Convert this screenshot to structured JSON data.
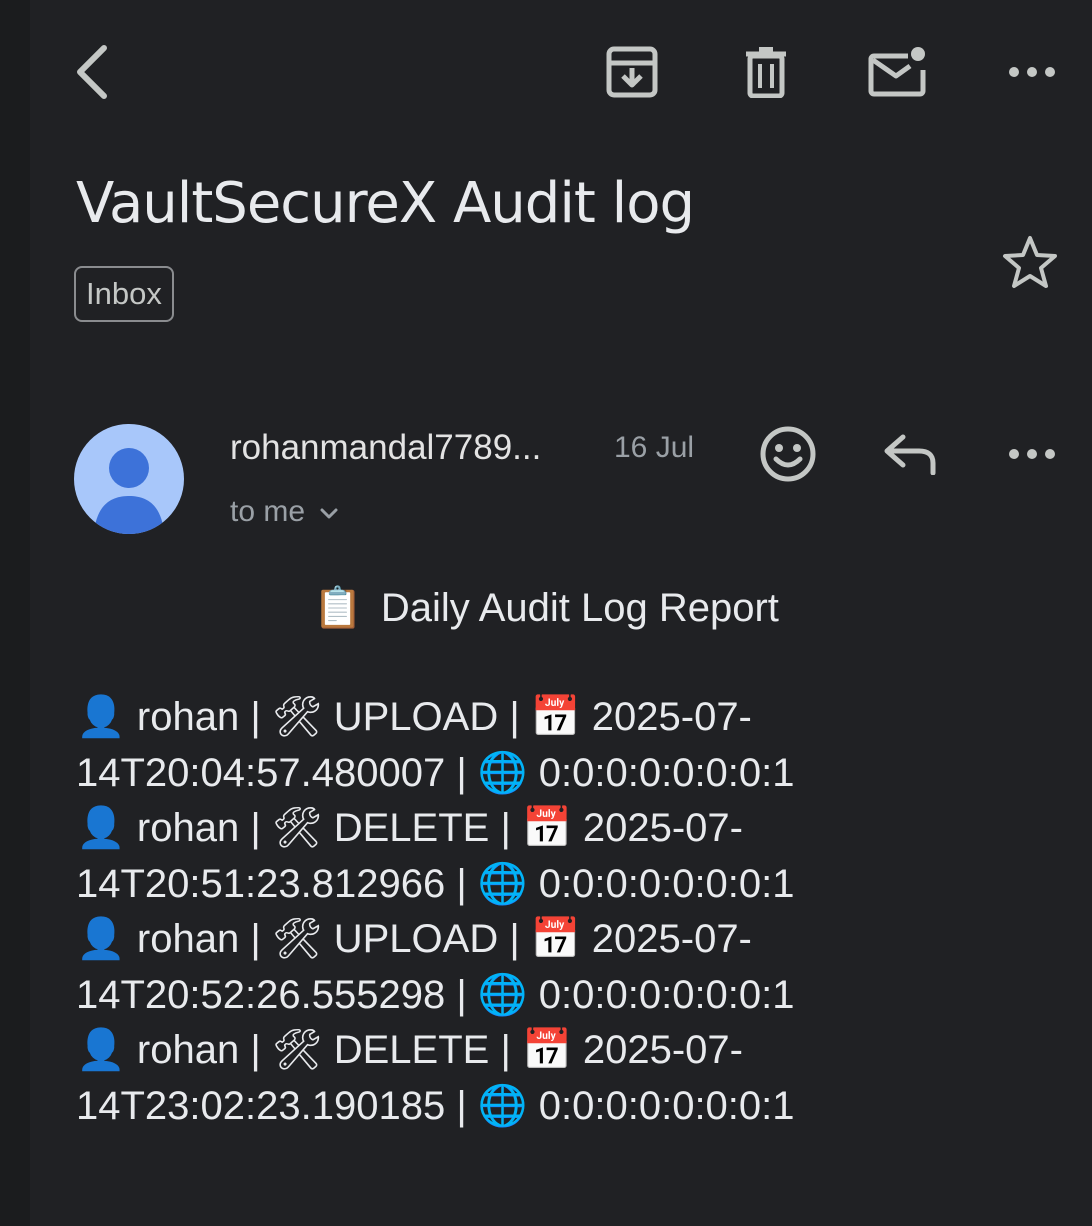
{
  "toolbar": {
    "back_icon": "chevron-left-icon",
    "archive_icon": "archive-icon",
    "delete_icon": "trash-icon",
    "unread_icon": "mark-unread-icon",
    "more_icon": "more-horizontal-icon"
  },
  "email": {
    "subject": "VaultSecureX Audit log",
    "label": "Inbox",
    "star_icon": "star-outline-icon"
  },
  "sender": {
    "name": "rohanmandal7789...",
    "date": "16 Jul",
    "recipient": "to me",
    "avatar_color": "#a8c7fa",
    "avatar_icon": "person-icon"
  },
  "message_actions": {
    "emoji_icon": "emoji-reaction-icon",
    "reply_icon": "reply-icon",
    "more_icon": "more-horizontal-icon"
  },
  "body": {
    "report_icon": "📋",
    "report_title": "Daily Audit Log Report",
    "entries": [
      {
        "line1": "👤 rohan | 🛠 UPLOAD | 📅 2025-07-",
        "line2": "14T20:04:57.480007 | 🌐 0:0:0:0:0:0:0:1"
      },
      {
        "line1": "👤 rohan | 🛠 DELETE | 📅 2025-07-",
        "line2": "14T20:51:23.812966 | 🌐 0:0:0:0:0:0:0:1"
      },
      {
        "line1": "👤 rohan | 🛠 UPLOAD | 📅 2025-07-",
        "line2": "14T20:52:26.555298 | 🌐 0:0:0:0:0:0:0:1"
      },
      {
        "line1": "👤 rohan | 🛠 DELETE | 📅 2025-07-",
        "line2": "14T23:02:23.190185 | 🌐 0:0:0:0:0:0:0:1"
      }
    ]
  },
  "colors": {
    "background": "#202124",
    "text": "#e8eaed",
    "secondary_text": "#9aa0a6",
    "icon": "#c4c7c5"
  }
}
